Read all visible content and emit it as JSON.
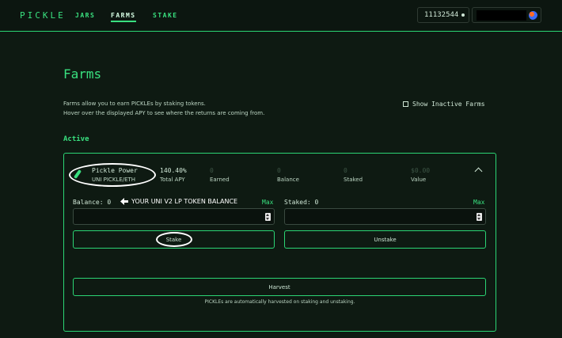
{
  "nav": {
    "brand": "PICKLE",
    "items": [
      {
        "label": "JARS",
        "active": false
      },
      {
        "label": "FARMS",
        "active": true
      },
      {
        "label": "STAKE",
        "active": false
      }
    ]
  },
  "header": {
    "block_number": "11132544"
  },
  "page": {
    "title": "Farms",
    "description_line1": "Farms allow you to earn PICKLEs by staking tokens.",
    "description_line2": "Hover over the displayed APY to see where the returns are coming from.",
    "show_inactive_label": "Show Inactive Farms",
    "section_label": "Active"
  },
  "farm": {
    "name": "Pickle Power",
    "pair": "UNI PICKLE/ETH",
    "total_apy_value": "140.40%",
    "total_apy_label": "Total APY",
    "earned_value": "0",
    "earned_label": "Earned",
    "balance_value": "0",
    "balance_label": "Balance",
    "staked_value": "0",
    "staked_label": "Staked",
    "value_value": "$0.00",
    "value_label": "Value",
    "balance_field_label": "Balance: 0",
    "staked_field_label": "Staked: 0",
    "max_label": "Max",
    "annotation": "YOUR UNI V2 LP TOKEN BALANCE",
    "stake_button": "Stake",
    "unstake_button": "Unstake",
    "harvest_button": "Harvest",
    "footnote": "PICKLEs are automatically harvested on staking and unstaking."
  },
  "colors": {
    "accent": "#39e07f",
    "border": "#2bd574",
    "background": "#0e1a12"
  }
}
